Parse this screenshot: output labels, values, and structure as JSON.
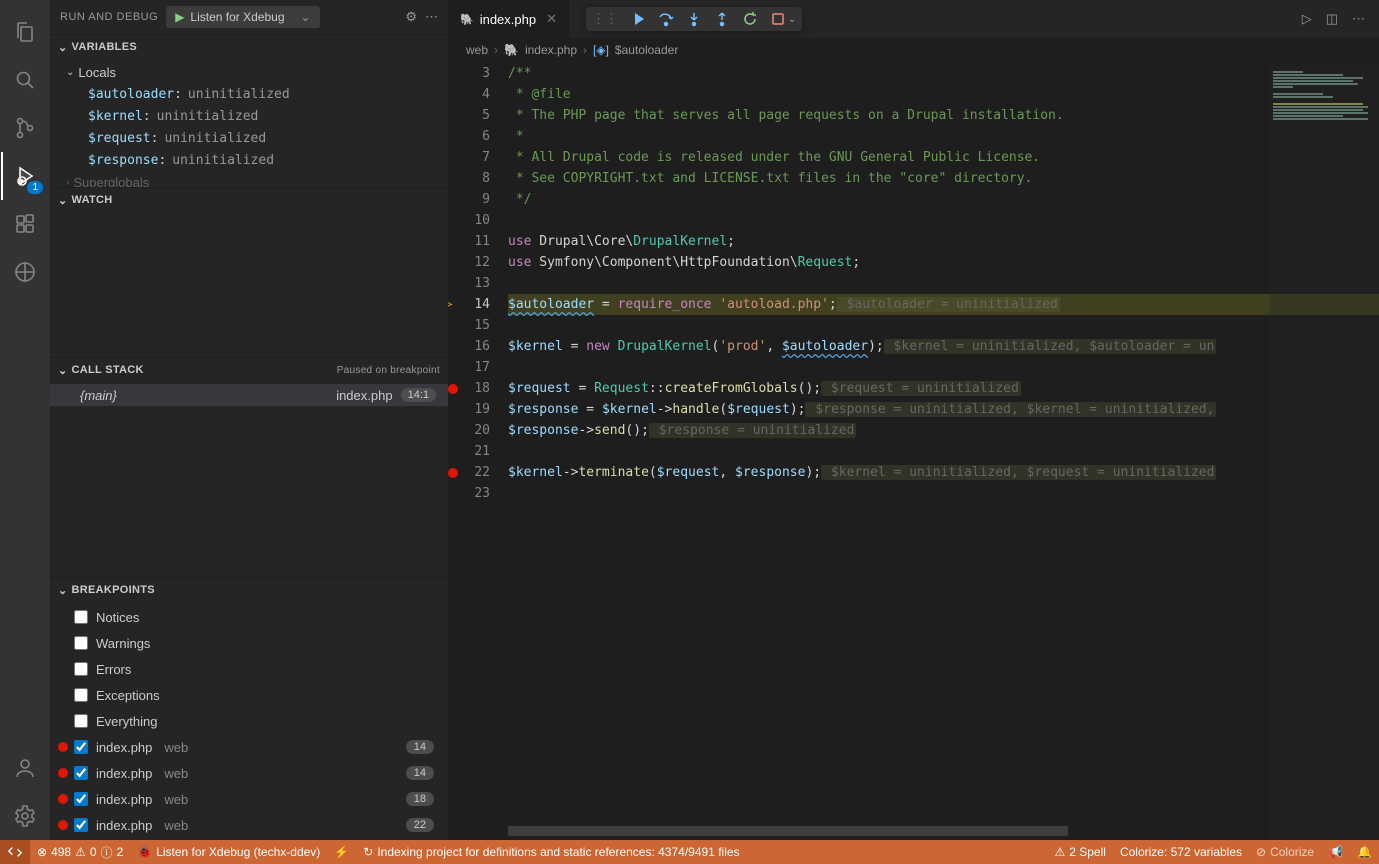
{
  "activity": {
    "debug_badge": "1"
  },
  "sidebar": {
    "title": "RUN AND DEBUG",
    "config": "Listen for Xdebug",
    "sections": {
      "variables": {
        "title": "VARIABLES",
        "locals_label": "Locals",
        "vars": [
          {
            "name": "$autoloader",
            "value": "uninitialized"
          },
          {
            "name": "$kernel",
            "value": "uninitialized"
          },
          {
            "name": "$request",
            "value": "uninitialized"
          },
          {
            "name": "$response",
            "value": "uninitialized"
          }
        ],
        "more_label": "Superglobals"
      },
      "watch": {
        "title": "WATCH"
      },
      "callstack": {
        "title": "CALL STACK",
        "status": "Paused on breakpoint",
        "frames": [
          {
            "name": "{main}",
            "file": "index.php",
            "loc": "14:1"
          }
        ]
      },
      "breakpoints": {
        "title": "BREAKPOINTS",
        "options": [
          "Notices",
          "Warnings",
          "Errors",
          "Exceptions",
          "Everything"
        ],
        "bps": [
          {
            "file": "index.php",
            "folder": "web",
            "line": "14"
          },
          {
            "file": "index.php",
            "folder": "web",
            "line": "14"
          },
          {
            "file": "index.php",
            "folder": "web",
            "line": "18"
          },
          {
            "file": "index.php",
            "folder": "web",
            "line": "22"
          }
        ]
      }
    }
  },
  "editor": {
    "tab": {
      "icon": "php",
      "label": "index.php"
    },
    "breadcrumb": [
      "web",
      "index.php",
      "$autoloader"
    ],
    "lines_start": 3,
    "code": {
      "l3": "/**",
      "l4": " * @file",
      "l5": " * The PHP page that serves all page requests on a Drupal installation.",
      "l6": " *",
      "l7": " * All Drupal code is released under the GNU General Public License.",
      "l8": " * See COPYRIGHT.txt and LICENSE.txt files in the \"core\" directory.",
      "l9": " */",
      "l10": "",
      "l11_use": "use",
      "l11_ns": " Drupal\\Core\\",
      "l11_cls": "DrupalKernel",
      "l11_end": ";",
      "l12_use": "use",
      "l12_ns": " Symfony\\Component\\HttpFoundation\\",
      "l12_cls": "Request",
      "l12_end": ";",
      "l14_var": "$autoloader",
      "l14_op": " = ",
      "l14_kw": "require_once",
      "l14_sp": " ",
      "l14_str": "'autoload.php'",
      "l14_end": ";",
      "l14_hint": " $autoloader = uninitialized",
      "l16_var": "$kernel",
      "l16_op": " = ",
      "l16_kw": "new",
      "l16_sp": " ",
      "l16_cls": "DrupalKernel",
      "l16_p1": "(",
      "l16_str": "'prod'",
      "l16_comma": ", ",
      "l16_var2": "$autoloader",
      "l16_p2": ");",
      "l16_hint": " $kernel = uninitialized, $autoloader = un",
      "l18_var": "$request",
      "l18_op": " = ",
      "l18_cls": "Request",
      "l18_sc": "::",
      "l18_fn": "createFromGlobals",
      "l18_p": "();",
      "l18_hint": " $request = uninitialized",
      "l19_var": "$response",
      "l19_op": " = ",
      "l19_var2": "$kernel",
      "l19_arr": "->",
      "l19_fn": "handle",
      "l19_p1": "(",
      "l19_var3": "$request",
      "l19_p2": ");",
      "l19_hint": " $response = uninitialized, $kernel = uninitialized,",
      "l20_var": "$response",
      "l20_arr": "->",
      "l20_fn": "send",
      "l20_p": "();",
      "l20_hint": " $response = uninitialized",
      "l22_var": "$kernel",
      "l22_arr": "->",
      "l22_fn": "terminate",
      "l22_p1": "(",
      "l22_var2": "$request",
      "l22_comma": ", ",
      "l22_var3": "$response",
      "l22_p2": ");",
      "l22_hint": " $kernel = uninitialized, $request = uninitialized"
    },
    "gutter": {
      "bp_lines": [
        18,
        22
      ],
      "exec_line": 14
    }
  },
  "statusbar": {
    "errors": "498",
    "warnings": "0",
    "info": "2",
    "debug": "Listen for Xdebug (techx-ddev)",
    "indexing": "Indexing project for definitions and static references: 4374/9491 files",
    "spell": "2 Spell",
    "colorize": "Colorize: 572 variables",
    "colorize_btn": "Colorize"
  }
}
